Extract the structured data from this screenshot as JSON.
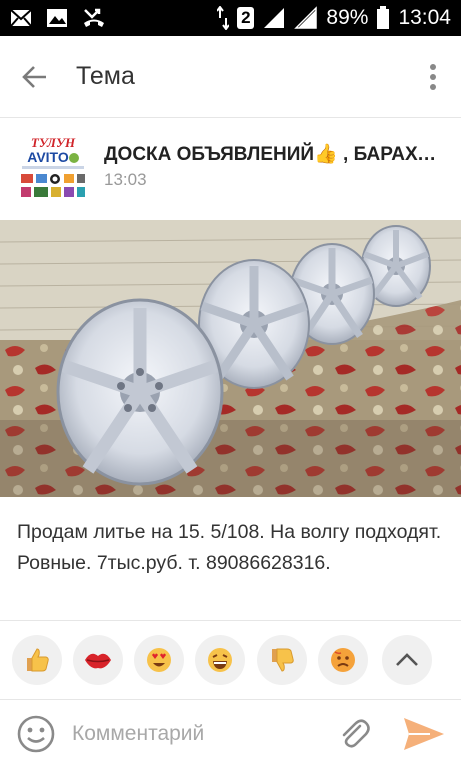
{
  "status_bar": {
    "icons_left": [
      "mail-icon",
      "image-icon",
      "missed-call-icon"
    ],
    "sim_label": "2",
    "battery_percent": "89%",
    "time": "13:04"
  },
  "app_bar": {
    "title": "Тема"
  },
  "group": {
    "logo_text_top": "ТУЛУН",
    "logo_text_brand": "AVITO",
    "name": "ДОСКА ОБЪЯВЛЕНИЙ👍 ,  БАРАХОЛКА",
    "time": "13:03"
  },
  "post": {
    "text": "Продам литье на 15. 5/108. На волгу подходят. Ровные. 7тыс.руб. т. 89086628316."
  },
  "reactions": [
    "thumbs-up-icon",
    "kiss-lips-icon",
    "heart-eyes-icon",
    "laughing-icon",
    "thumbs-down-icon",
    "sad-face-icon",
    "collapse-chevron-icon"
  ],
  "comment": {
    "placeholder": "Комментарий"
  },
  "colors": {
    "accent": "#ee8208",
    "send": "#f5b07a",
    "reaction_bg": "#f0f0f0",
    "status_bar": "#000000"
  }
}
